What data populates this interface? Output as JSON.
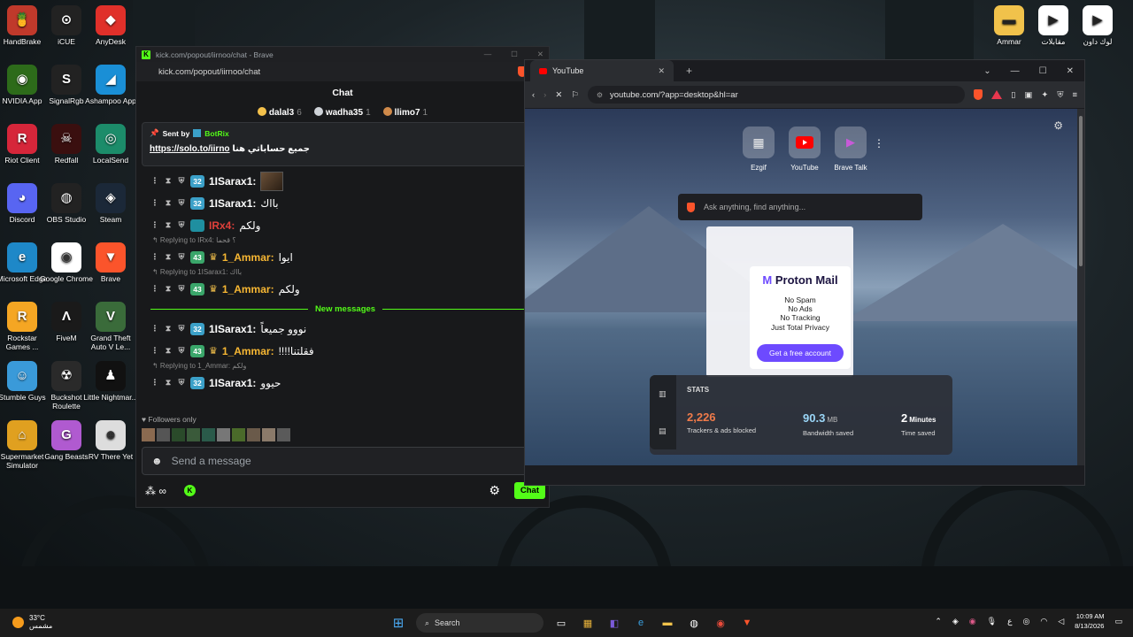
{
  "desktop": {
    "left_icons": [
      {
        "label": "HandBrake",
        "color": "#c0392b",
        "glyph": "🍍"
      },
      {
        "label": "iCUE",
        "color": "#222",
        "glyph": "⊙"
      },
      {
        "label": "AnyDesk",
        "color": "#e0302a",
        "glyph": "◆"
      },
      {
        "label": "NVIDIA App",
        "color": "#2d6b1a",
        "glyph": "◉"
      },
      {
        "label": "SignalRgb",
        "color": "#222",
        "glyph": "S"
      },
      {
        "label": "Ashampoo App",
        "color": "#1a8fd6",
        "glyph": "◢"
      },
      {
        "label": "Riot Client",
        "color": "#d6263a",
        "glyph": "R"
      },
      {
        "label": "Redfall",
        "color": "#3a0f0f",
        "glyph": "☠"
      },
      {
        "label": "LocalSend",
        "color": "#1c8c6a",
        "glyph": "◎"
      },
      {
        "label": "Discord",
        "color": "#5865f2",
        "glyph": "◕"
      },
      {
        "label": "OBS Studio",
        "color": "#222",
        "glyph": "◍"
      },
      {
        "label": "Steam",
        "color": "#1b2838",
        "glyph": "◈"
      },
      {
        "label": "Microsoft Edge",
        "color": "#1e88c8",
        "glyph": "e"
      },
      {
        "label": "Google Chrome",
        "color": "#fff",
        "glyph": "◉"
      },
      {
        "label": "Brave",
        "color": "#fb542b",
        "glyph": "▼"
      },
      {
        "label": "Rockstar Games ...",
        "color": "#f5a623",
        "glyph": "R"
      },
      {
        "label": "FiveM",
        "color": "#1a1a1a",
        "glyph": "Λ"
      },
      {
        "label": "Grand Theft Auto V Le...",
        "color": "#3a6b3a",
        "glyph": "V"
      },
      {
        "label": "Stumble Guys",
        "color": "#3a9ad9",
        "glyph": "☺"
      },
      {
        "label": "Buckshot Roulette",
        "color": "#2a2a2a",
        "glyph": "☢"
      },
      {
        "label": "Little Nightmar...",
        "color": "#111",
        "glyph": "♟"
      },
      {
        "label": "Supermarket Simulator",
        "color": "#e0a020",
        "glyph": "⌂"
      },
      {
        "label": "Gang Beasts",
        "color": "#b05ad0",
        "glyph": "G"
      },
      {
        "label": "RV There Yet",
        "color": "#ddd",
        "glyph": "☻"
      }
    ],
    "right_icons": [
      {
        "label": "Ammar",
        "color": "#f1c24b",
        "glyph": "▬"
      },
      {
        "label": "مقابلات",
        "color": "#fff",
        "glyph": "▶"
      },
      {
        "label": "لوك داون",
        "color": "#fff",
        "glyph": "▶"
      }
    ]
  },
  "chat_window": {
    "title": "kick.com/popout/iirnoo/chat - Brave",
    "url": "kick.com/popout/iirnoo/chat",
    "header": "Chat",
    "leaders": [
      {
        "name": "dalal3",
        "count": "6",
        "color": "#f4c14b"
      },
      {
        "name": "wadha35",
        "count": "1",
        "color": "#cfd3d8"
      },
      {
        "name": "llimo7",
        "count": "1",
        "color": "#d08a4a"
      }
    ],
    "pinned": {
      "sent_by_label": "Sent by",
      "bot_name": "BotRix",
      "link_text": "https://solo.to/iirno",
      "message": "جميع حساباتي هنا"
    },
    "messages": [
      {
        "type": "msg",
        "level": "32",
        "name": "1ISarax1:",
        "text": "",
        "name_style": "white",
        "has_avatar": true
      },
      {
        "type": "msg",
        "level": "32",
        "name": "1ISarax1:",
        "text": "بااك",
        "name_style": "white"
      },
      {
        "type": "msg",
        "level": "",
        "name": "IRx4:",
        "text": "ولكم",
        "name_style": "red"
      },
      {
        "type": "reply",
        "text": "Replying to IRx4: ؟ قحما"
      },
      {
        "type": "msg",
        "level": "43",
        "name": "1_Ammar:",
        "text": "ايوا",
        "name_style": "orange",
        "crown": true
      },
      {
        "type": "reply",
        "text": "Replying to 1ISarax1: بااك"
      },
      {
        "type": "msg",
        "level": "43",
        "name": "1_Ammar:",
        "text": "ولكم",
        "name_style": "orange",
        "crown": true
      },
      {
        "type": "divider",
        "text": "New messages"
      },
      {
        "type": "msg",
        "level": "32",
        "name": "1ISarax1:",
        "text": "نووو جميعاً",
        "name_style": "white"
      },
      {
        "type": "msg",
        "level": "43",
        "name": "1_Ammar:",
        "text": "!!!!فقلتنا",
        "name_style": "orange",
        "crown": true
      },
      {
        "type": "reply",
        "text": "Replying to 1_Ammar: ولكم"
      },
      {
        "type": "msg",
        "level": "32",
        "name": "1ISarax1:",
        "text": "حيوو",
        "name_style": "white"
      }
    ],
    "followers_only": "Followers only",
    "input_placeholder": "Send a message",
    "chat_button": "Chat"
  },
  "browser": {
    "tab_title": "YouTube",
    "url": "youtube.com/?app=desktop&hl=ar",
    "tiles": [
      {
        "label": "Ezgif"
      },
      {
        "label": "YouTube"
      },
      {
        "label": "Brave Talk"
      }
    ],
    "search_placeholder": "Ask anything, find anything...",
    "ad": {
      "brand": "Proton Mail",
      "lines": [
        "No Spam",
        "No Ads",
        "No Tracking",
        "Just Total Privacy"
      ],
      "cta": "Get a free account"
    },
    "stats": {
      "title": "STATS",
      "trackers_value": "2,226",
      "trackers_label": "Trackers & ads blocked",
      "bandwidth_value": "90.3",
      "bandwidth_unit": "MB",
      "bandwidth_label": "Bandwidth saved",
      "time_value": "2",
      "time_unit": "Minutes",
      "time_label": "Time saved"
    }
  },
  "taskbar": {
    "temperature": "33°C",
    "weather_text": "مشمس",
    "search_label": "Search",
    "time": "10:09 AM",
    "date": "8/13/2026",
    "lang": "ع"
  }
}
